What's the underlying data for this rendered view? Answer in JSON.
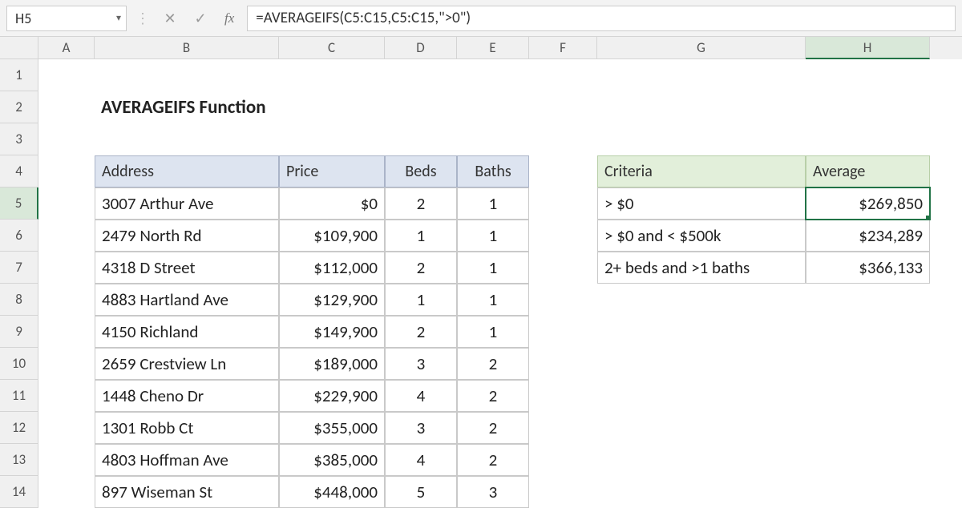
{
  "name_box": "H5",
  "formula": "=AVERAGEIFS(C5:C15,C5:C15,\">0\")",
  "fx_label": "fx",
  "columns": [
    "A",
    "B",
    "C",
    "D",
    "E",
    "F",
    "G",
    "H"
  ],
  "rows": [
    "1",
    "2",
    "3",
    "4",
    "5",
    "6",
    "7",
    "8",
    "9",
    "10",
    "11",
    "12",
    "13",
    "14"
  ],
  "title": "AVERAGEIFS Function",
  "table1": {
    "headers": {
      "address": "Address",
      "price": "Price",
      "beds": "Beds",
      "baths": "Baths"
    },
    "rows": [
      {
        "address": "3007 Arthur Ave",
        "price": "$0",
        "beds": "2",
        "baths": "1"
      },
      {
        "address": "2479 North Rd",
        "price": "$109,900",
        "beds": "1",
        "baths": "1"
      },
      {
        "address": "4318 D Street",
        "price": "$112,000",
        "beds": "2",
        "baths": "1"
      },
      {
        "address": "4883 Hartland Ave",
        "price": "$129,900",
        "beds": "1",
        "baths": "1"
      },
      {
        "address": "4150 Richland",
        "price": "$149,900",
        "beds": "2",
        "baths": "1"
      },
      {
        "address": "2659 Crestview Ln",
        "price": "$189,000",
        "beds": "3",
        "baths": "2"
      },
      {
        "address": "1448 Cheno Dr",
        "price": "$229,900",
        "beds": "4",
        "baths": "2"
      },
      {
        "address": "1301 Robb Ct",
        "price": "$355,000",
        "beds": "3",
        "baths": "2"
      },
      {
        "address": "4803 Hoffman Ave",
        "price": "$385,000",
        "beds": "4",
        "baths": "2"
      },
      {
        "address": "897 Wiseman St",
        "price": "$448,000",
        "beds": "5",
        "baths": "3"
      }
    ]
  },
  "table2": {
    "headers": {
      "criteria": "Criteria",
      "average": "Average"
    },
    "rows": [
      {
        "criteria": "> $0",
        "average": "$269,850"
      },
      {
        "criteria": "> $0 and < $500k",
        "average": "$234,289"
      },
      {
        "criteria": "2+ beds and >1 baths",
        "average": "$366,133"
      }
    ]
  },
  "icons": {
    "cancel": "✕",
    "enter": "✓",
    "dropdown": "▾",
    "sep": "⋮"
  }
}
